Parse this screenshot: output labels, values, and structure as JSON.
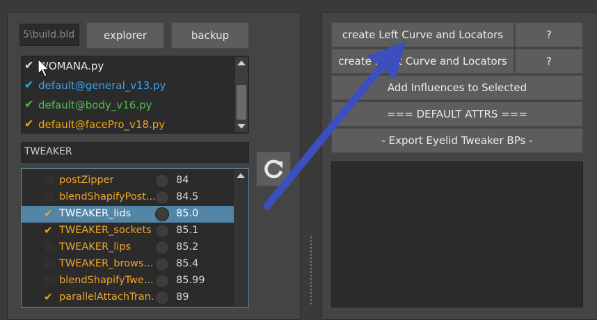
{
  "path_field": {
    "value": "5\\build.bld"
  },
  "buttons": {
    "explorer": "explorer",
    "backup": "backup"
  },
  "files": [
    {
      "label": "WOMANA.py",
      "check_color": "#e0e0e0",
      "text_color": "#e8e8e8"
    },
    {
      "label": "default@general_v13.py",
      "check_color": "#3ba3f0",
      "text_color": "#3ba3f0"
    },
    {
      "label": "default@body_v16.py",
      "check_color": "#4fbf4f",
      "text_color": "#4fbf4f"
    },
    {
      "label": "default@facePro_v18.py",
      "check_color": "#f2a417",
      "text_color": "#f2a417"
    }
  ],
  "filter": {
    "value": "TWEAKER"
  },
  "tree_items": [
    {
      "label": "postZipper",
      "value": "84",
      "checked": false,
      "selected": false
    },
    {
      "label": "blendShapifyPost...",
      "value": "84.5",
      "checked": false,
      "selected": false
    },
    {
      "label": "TWEAKER_lids",
      "value": "85.0",
      "checked": true,
      "selected": true
    },
    {
      "label": "TWEAKER_sockets",
      "value": "85.1",
      "checked": true,
      "selected": false
    },
    {
      "label": "TWEAKER_lips",
      "value": "85.2",
      "checked": false,
      "selected": false
    },
    {
      "label": "TWEAKER_brows...",
      "value": "85.4",
      "checked": false,
      "selected": false
    },
    {
      "label": "blendShapifyTwe...",
      "value": "85.99",
      "checked": false,
      "selected": false
    },
    {
      "label": "parallelAttachTran...",
      "value": "89",
      "checked": true,
      "selected": false
    }
  ],
  "right_buttons": {
    "create_left": "create Left Curve and Locators",
    "create_right": "create Right Curve and Locators",
    "help": "?",
    "add_influences": "Add Influences to Selected",
    "default_attrs": "=== DEFAULT ATTRS ===",
    "export_bps": "- Export Eyelid Tweaker BPs -"
  },
  "colors": {
    "accent_blue": "#3b4fbf",
    "selection": "#5285a6",
    "orange": "#f0a528"
  },
  "icons": {
    "refresh": "refresh-icon",
    "check": "checkmark-icon"
  }
}
